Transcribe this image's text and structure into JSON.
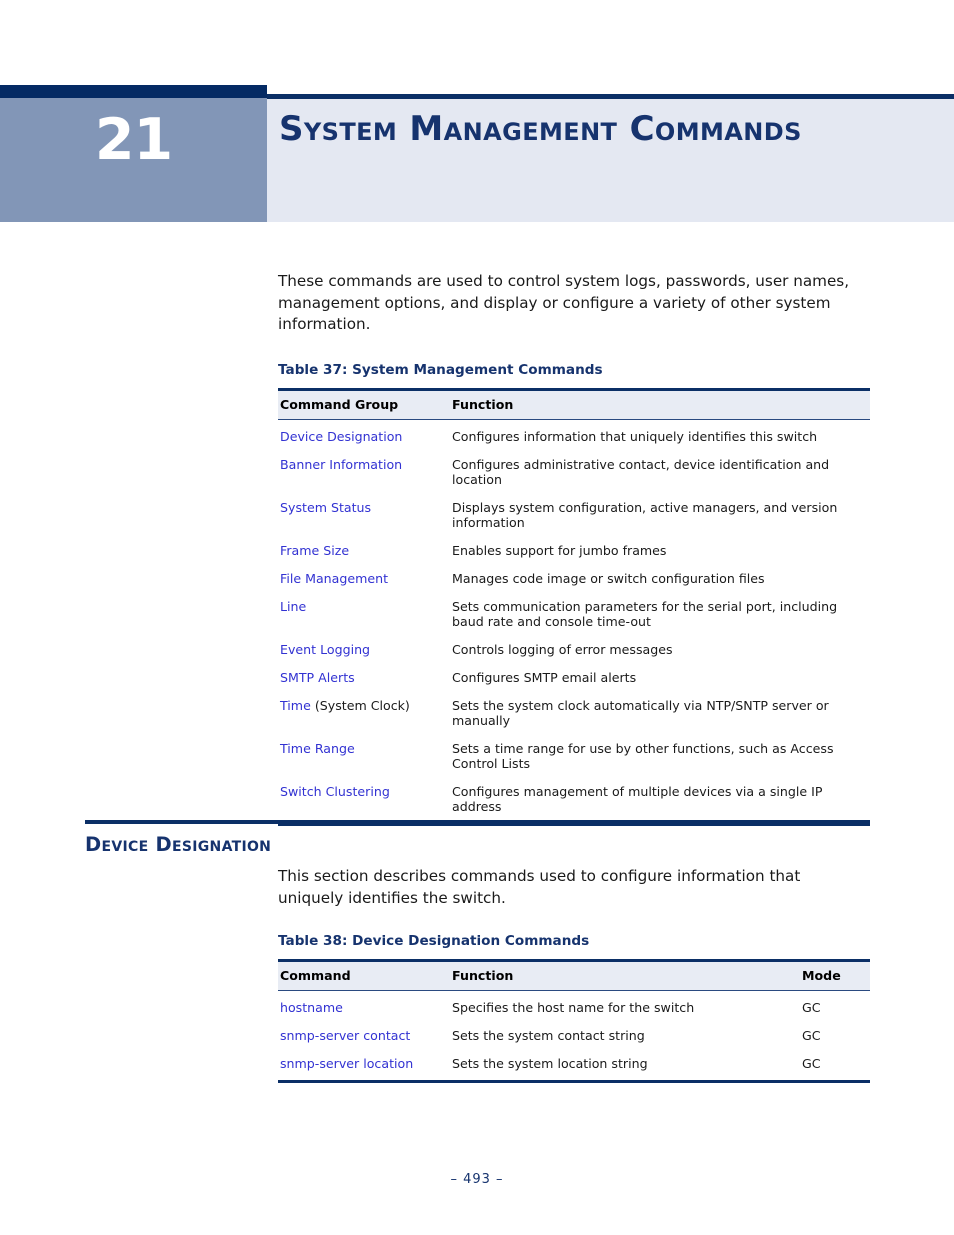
{
  "header": {
    "chapter_number": "21",
    "chapter_title": "System Management Commands"
  },
  "intro": {
    "paragraph": "These commands are used to control system logs, passwords, user names, management options, and display or configure a variety of other system information."
  },
  "table37": {
    "caption": "Table 37: System Management Commands",
    "columns": [
      "Command Group",
      "Function"
    ],
    "rows": [
      {
        "group": "Device Designation",
        "group_suffix": "",
        "function": "Configures information that uniquely identifies this switch"
      },
      {
        "group": "Banner Information",
        "group_suffix": "",
        "function": "Configures administrative contact, device identification and location"
      },
      {
        "group": "System Status",
        "group_suffix": "",
        "function": "Displays system configuration, active managers, and version information"
      },
      {
        "group": "Frame Size",
        "group_suffix": "",
        "function": "Enables support for jumbo frames"
      },
      {
        "group": "File Management",
        "group_suffix": "",
        "function": "Manages code image or switch configuration files"
      },
      {
        "group": "Line",
        "group_suffix": "",
        "function": "Sets communication parameters for the serial port, including baud rate and console time-out"
      },
      {
        "group": "Event Logging",
        "group_suffix": "",
        "function": "Controls logging of error messages"
      },
      {
        "group": "SMTP Alerts",
        "group_suffix": "",
        "function": "Configures SMTP email alerts"
      },
      {
        "group": "Time",
        "group_suffix": " (System Clock)",
        "function": "Sets the system clock automatically via NTP/SNTP server or manually"
      },
      {
        "group": "Time Range",
        "group_suffix": "",
        "function": "Sets a time range for use by other functions, such as Access Control Lists"
      },
      {
        "group": "Switch Clustering",
        "group_suffix": "",
        "function": "Configures management of multiple devices via a single IP address"
      }
    ]
  },
  "section": {
    "heading": "Device Designation",
    "paragraph": "This section describes commands used to configure information that uniquely identifies the switch."
  },
  "table38": {
    "caption": "Table 38: Device Designation Commands",
    "columns": [
      "Command",
      "Function",
      "Mode"
    ],
    "rows": [
      {
        "command": "hostname",
        "function": "Specifies the host name for the switch",
        "mode": "GC"
      },
      {
        "command": "snmp-server contact",
        "function": "Sets the system contact string",
        "mode": "GC"
      },
      {
        "command": "snmp-server location",
        "function": "Sets the system location string",
        "mode": "GC"
      }
    ]
  },
  "footer": {
    "page_number": "–  493  –"
  },
  "colors": {
    "navy": "#0b2f66",
    "title_navy": "#16336e",
    "chapter_block": "#8296b7",
    "title_bg": "#e4e8f2",
    "table_header_bg": "#e8ecf4",
    "link_blue": "#3232d2"
  }
}
